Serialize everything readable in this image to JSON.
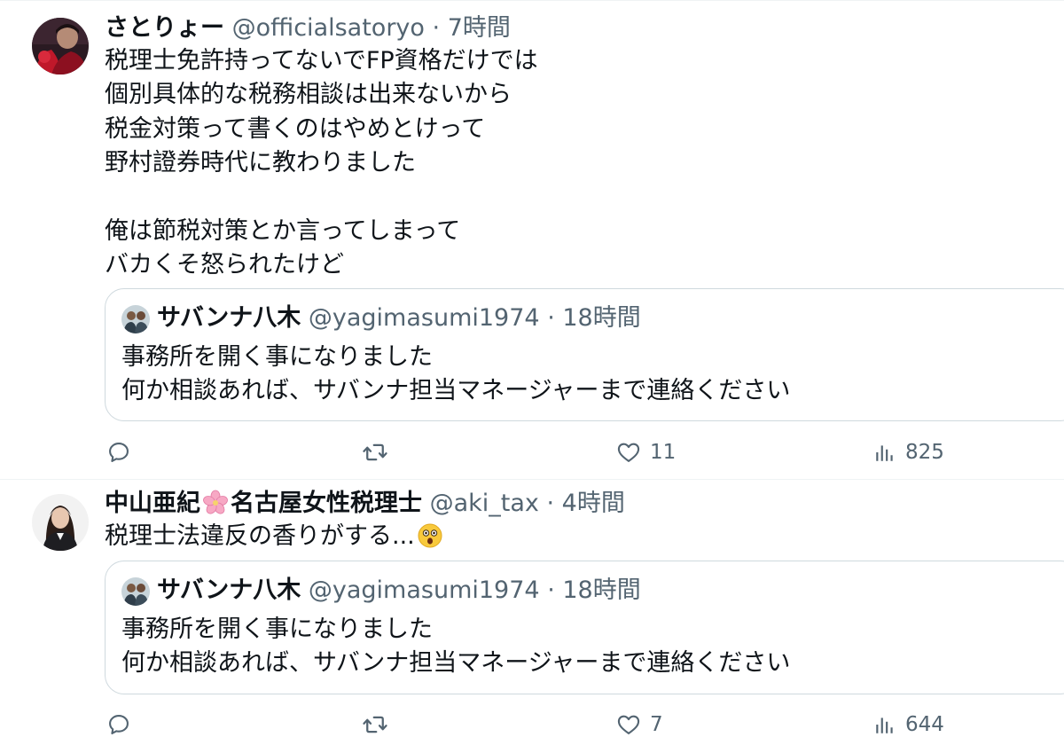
{
  "tweets": [
    {
      "author": {
        "name": "さとりょー",
        "handle": "@officialsatoryo",
        "separator": "·",
        "time": "7時間",
        "avatar_icon": "user-avatar-photo"
      },
      "text_lines": [
        "税理士免許持ってないでFP資格だけでは",
        "個別具体的な税務相談は出来ないから",
        "税金対策って書くのはやめとけって",
        "野村證券時代に教わりました",
        "",
        "俺は節税対策とか言ってしまって",
        "バカくそ怒られたけど"
      ],
      "quote": {
        "name": "サバンナ八木",
        "handle": "@yagimasumi1974",
        "separator": "·",
        "time": "18時間",
        "text_lines": [
          "事務所を開く事になりました",
          "何か相談あれば、サバンナ担当マネージャーまで連絡ください"
        ]
      },
      "actions": {
        "reply_icon": "reply-icon",
        "retweet_icon": "retweet-icon",
        "like_icon": "heart-icon",
        "like_count": "11",
        "views_icon": "views-icon",
        "views_count": "825"
      }
    },
    {
      "author": {
        "name_part1": "中山亜紀",
        "name_emoji": "cherry-blossom-emoji",
        "name_part2": "名古屋女性税理士",
        "handle": "@aki_tax",
        "separator": "·",
        "time": "4時間",
        "avatar_icon": "user-avatar-photo"
      },
      "text": "税理士法違反の香りがする...",
      "text_emoji": "astonished-face-emoji",
      "quote": {
        "name": "サバンナ八木",
        "handle": "@yagimasumi1974",
        "separator": "·",
        "time": "18時間",
        "text_lines": [
          "事務所を開く事になりました",
          "何か相談あれば、サバンナ担当マネージャーまで連絡ください"
        ]
      },
      "actions": {
        "reply_icon": "reply-icon",
        "retweet_icon": "retweet-icon",
        "like_icon": "heart-icon",
        "like_count": "7",
        "views_icon": "views-icon",
        "views_count": "644"
      }
    }
  ],
  "colors": {
    "text_primary": "#0f1419",
    "text_secondary": "#536471",
    "border": "#cfd9de",
    "divider": "#eff3f4"
  }
}
